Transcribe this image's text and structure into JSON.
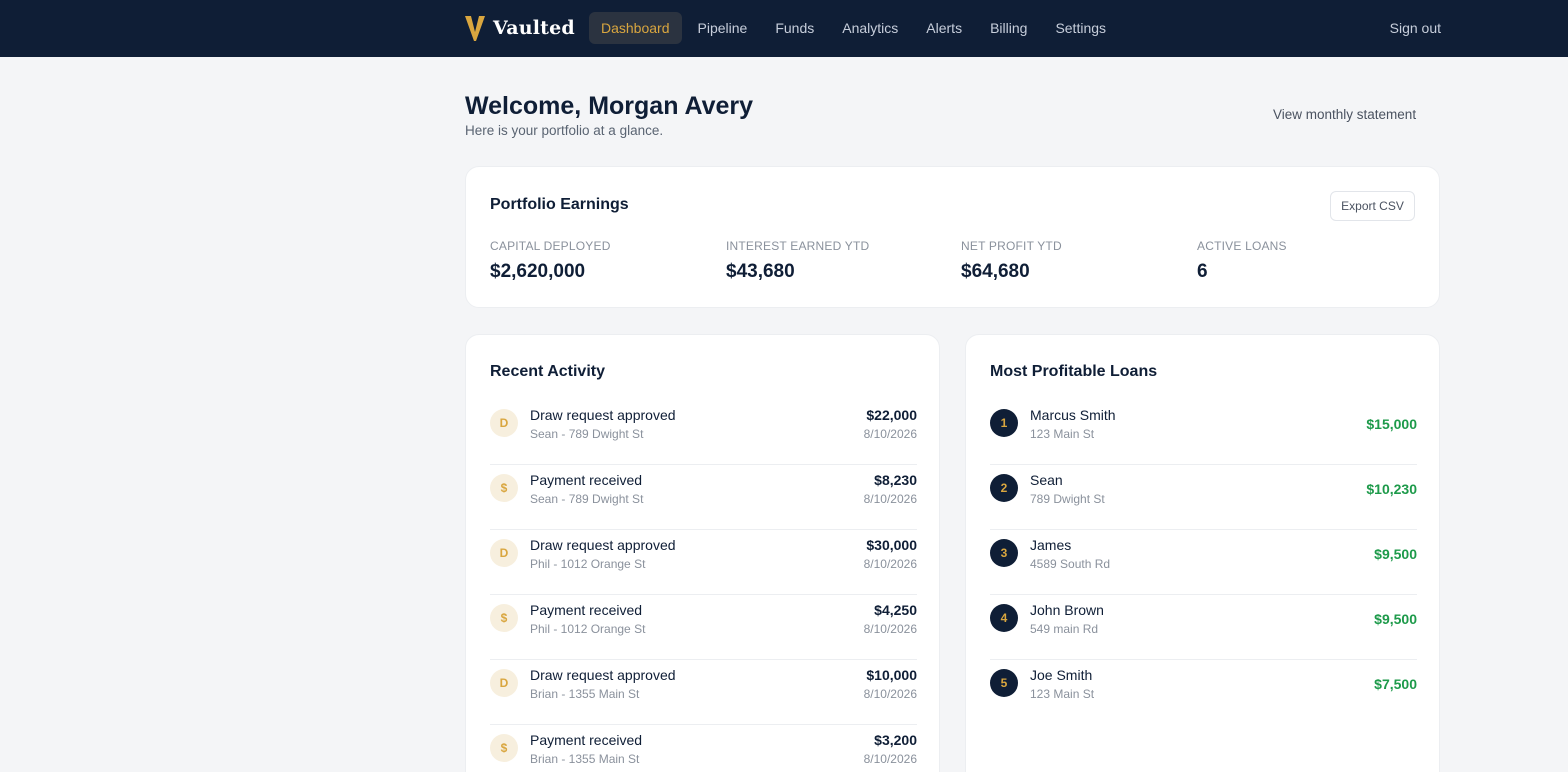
{
  "brand": {
    "name": "Vaulted",
    "logo_icon": "v-logo-icon",
    "accent_color": "#d9a63f"
  },
  "nav": {
    "items": [
      "Dashboard",
      "Pipeline",
      "Funds",
      "Analytics",
      "Alerts",
      "Billing",
      "Settings"
    ],
    "active": "Dashboard",
    "sign_out": "Sign out"
  },
  "header": {
    "welcome": "Welcome, Morgan Avery",
    "subtitle": "Here is your portfolio at a glance.",
    "statement_link": "View monthly statement"
  },
  "earnings": {
    "title": "Portfolio Earnings",
    "export_label": "Export CSV",
    "metrics": [
      {
        "label": "Capital Deployed",
        "value": "$2,620,000"
      },
      {
        "label": "Interest Earned YTD",
        "value": "$43,680"
      },
      {
        "label": "Net Profit YTD",
        "value": "$64,680"
      },
      {
        "label": "Active Loans",
        "value": "6"
      }
    ]
  },
  "activity": {
    "title": "Recent Activity",
    "items": [
      {
        "badge": "D",
        "title": "Draw request approved",
        "sub": "Sean - 789 Dwight St",
        "amount": "$22,000",
        "date": "8/10/2026"
      },
      {
        "badge": "$",
        "title": "Payment received",
        "sub": "Sean - 789 Dwight St",
        "amount": "$8,230",
        "date": "8/10/2026"
      },
      {
        "badge": "D",
        "title": "Draw request approved",
        "sub": "Phil - 1012 Orange St",
        "amount": "$30,000",
        "date": "8/10/2026"
      },
      {
        "badge": "$",
        "title": "Payment received",
        "sub": "Phil - 1012 Orange St",
        "amount": "$4,250",
        "date": "8/10/2026"
      },
      {
        "badge": "D",
        "title": "Draw request approved",
        "sub": "Brian - 1355 Main St",
        "amount": "$10,000",
        "date": "8/10/2026"
      },
      {
        "badge": "$",
        "title": "Payment received",
        "sub": "Brian - 1355 Main St",
        "amount": "$3,200",
        "date": "8/10/2026"
      }
    ]
  },
  "loans": {
    "title": "Most Profitable Loans",
    "profit_color": "#1d9a4a",
    "items": [
      {
        "rank": "1",
        "name": "Marcus Smith",
        "address": "123 Main St",
        "profit": "$15,000"
      },
      {
        "rank": "2",
        "name": "Sean",
        "address": "789 Dwight St",
        "profit": "$10,230"
      },
      {
        "rank": "3",
        "name": "James",
        "address": "4589 South Rd",
        "profit": "$9,500"
      },
      {
        "rank": "4",
        "name": "John Brown",
        "address": "549 main Rd",
        "profit": "$9,500"
      },
      {
        "rank": "5",
        "name": "Joe Smith",
        "address": "123 Main St",
        "profit": "$7,500"
      }
    ]
  }
}
